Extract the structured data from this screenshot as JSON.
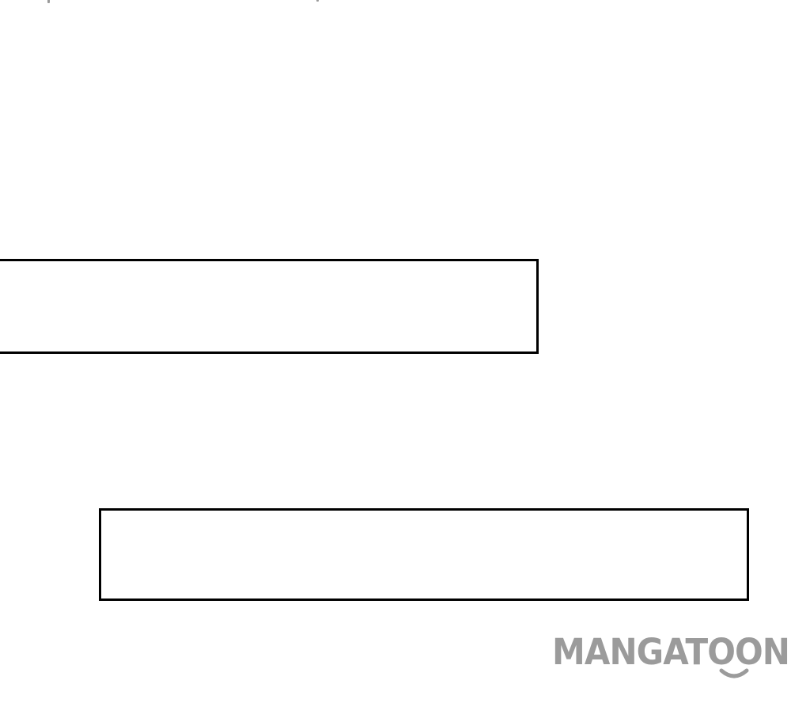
{
  "watermark": {
    "text": "MANGATOON",
    "color": "#9b9b9b"
  },
  "caption_boxes": [
    {
      "text": ""
    },
    {
      "text": ""
    }
  ],
  "colors": {
    "background": "#ffffff",
    "box_border": "#000000"
  }
}
